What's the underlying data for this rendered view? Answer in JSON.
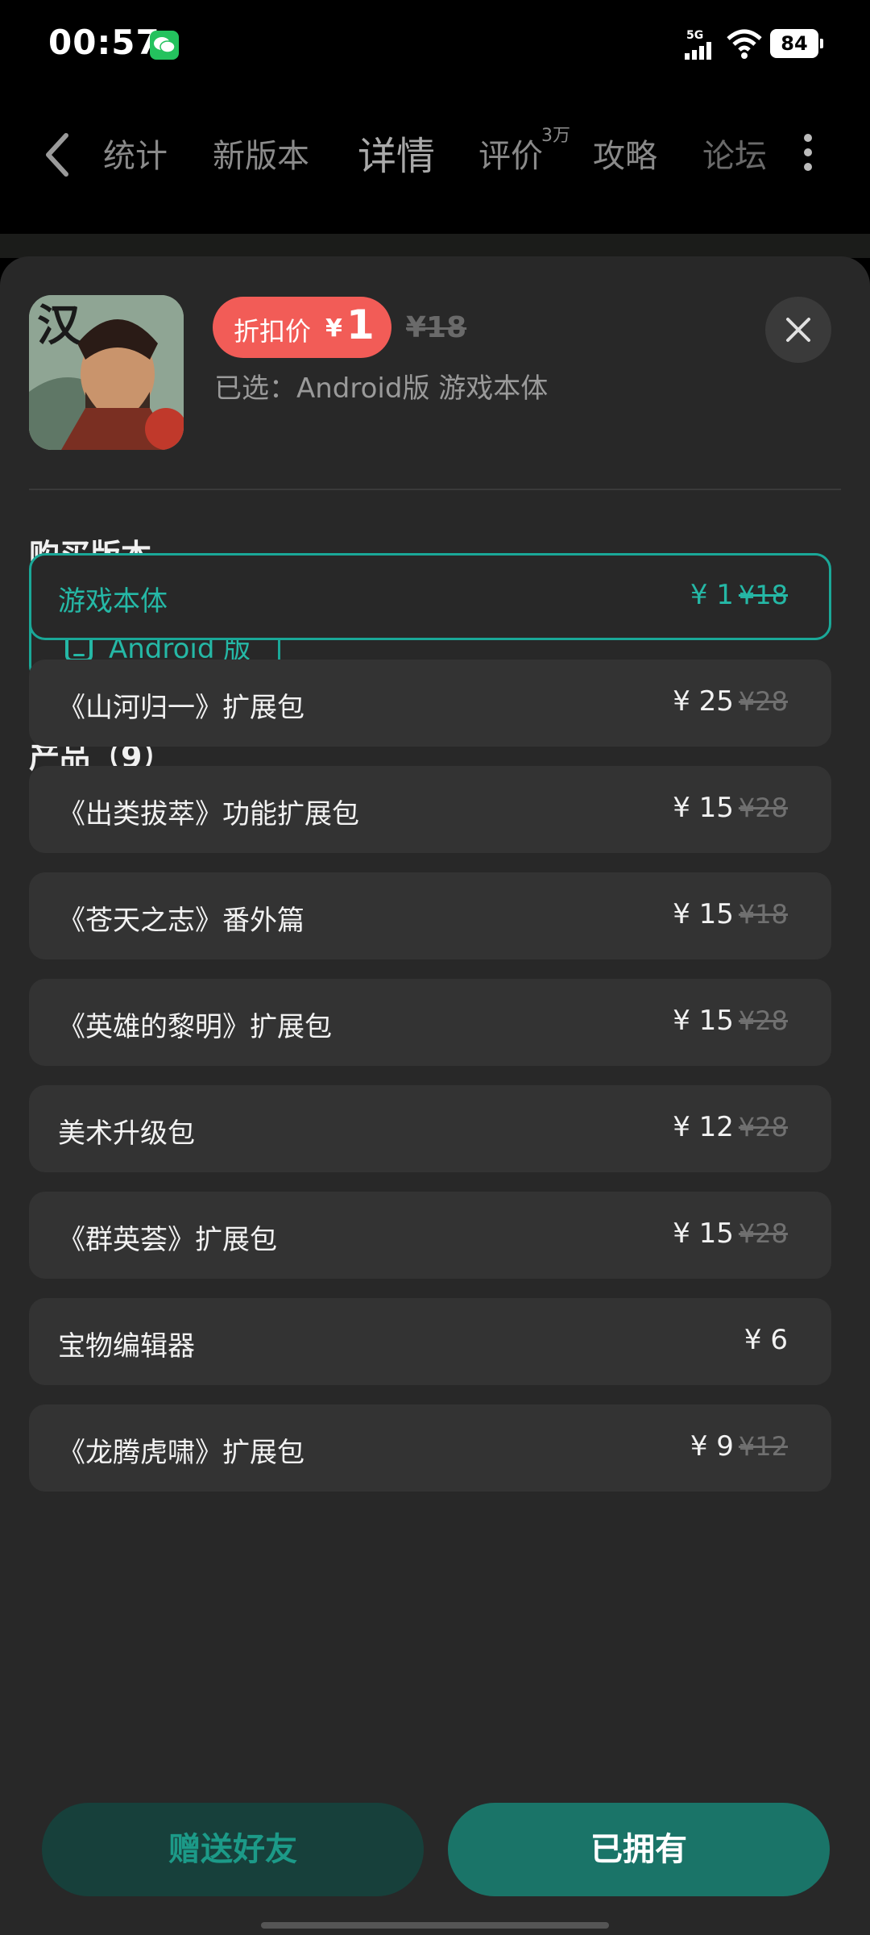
{
  "status_bar": {
    "time": "00:57",
    "network": "5G",
    "battery": "84"
  },
  "nav": {
    "tabs": [
      {
        "label": "统计"
      },
      {
        "label": "新版本"
      },
      {
        "label": "详情",
        "active": true
      },
      {
        "label": "评价",
        "badge": "3万"
      },
      {
        "label": "攻略"
      },
      {
        "label": "论坛"
      }
    ]
  },
  "purchase": {
    "discount_label": "折扣价",
    "currency": "¥",
    "discount_value": "1",
    "original_price": "¥18",
    "selected_text": "已选：Android版 游戏本体",
    "version_title": "购买版本",
    "platform_label": "Android 版",
    "products_title": "产品（9）",
    "products": [
      {
        "name": "游戏本体",
        "price": "¥ 1",
        "old": "¥18",
        "selected": true
      },
      {
        "name": "《山河归一》扩展包",
        "price": "¥ 25",
        "old": "¥28"
      },
      {
        "name": "《出类拔萃》功能扩展包",
        "price": "¥ 15",
        "old": "¥28"
      },
      {
        "name": "《苍天之志》番外篇",
        "price": "¥ 15",
        "old": "¥18"
      },
      {
        "name": "《英雄的黎明》扩展包",
        "price": "¥ 15",
        "old": "¥28"
      },
      {
        "name": "美术升级包",
        "price": "¥ 12",
        "old": "¥28"
      },
      {
        "name": "《群英荟》扩展包",
        "price": "¥ 15",
        "old": "¥28"
      },
      {
        "name": "宝物编辑器",
        "price": "¥ 6",
        "old": ""
      },
      {
        "name": "《龙腾虎啸》扩展包",
        "price": "¥ 9",
        "old": "¥12"
      }
    ],
    "gift_button": "赠送好友",
    "owned_button": "已拥有"
  },
  "colors": {
    "accent": "#1aa898",
    "discount_red": "#f25c57",
    "sheet_bg": "#282828"
  }
}
